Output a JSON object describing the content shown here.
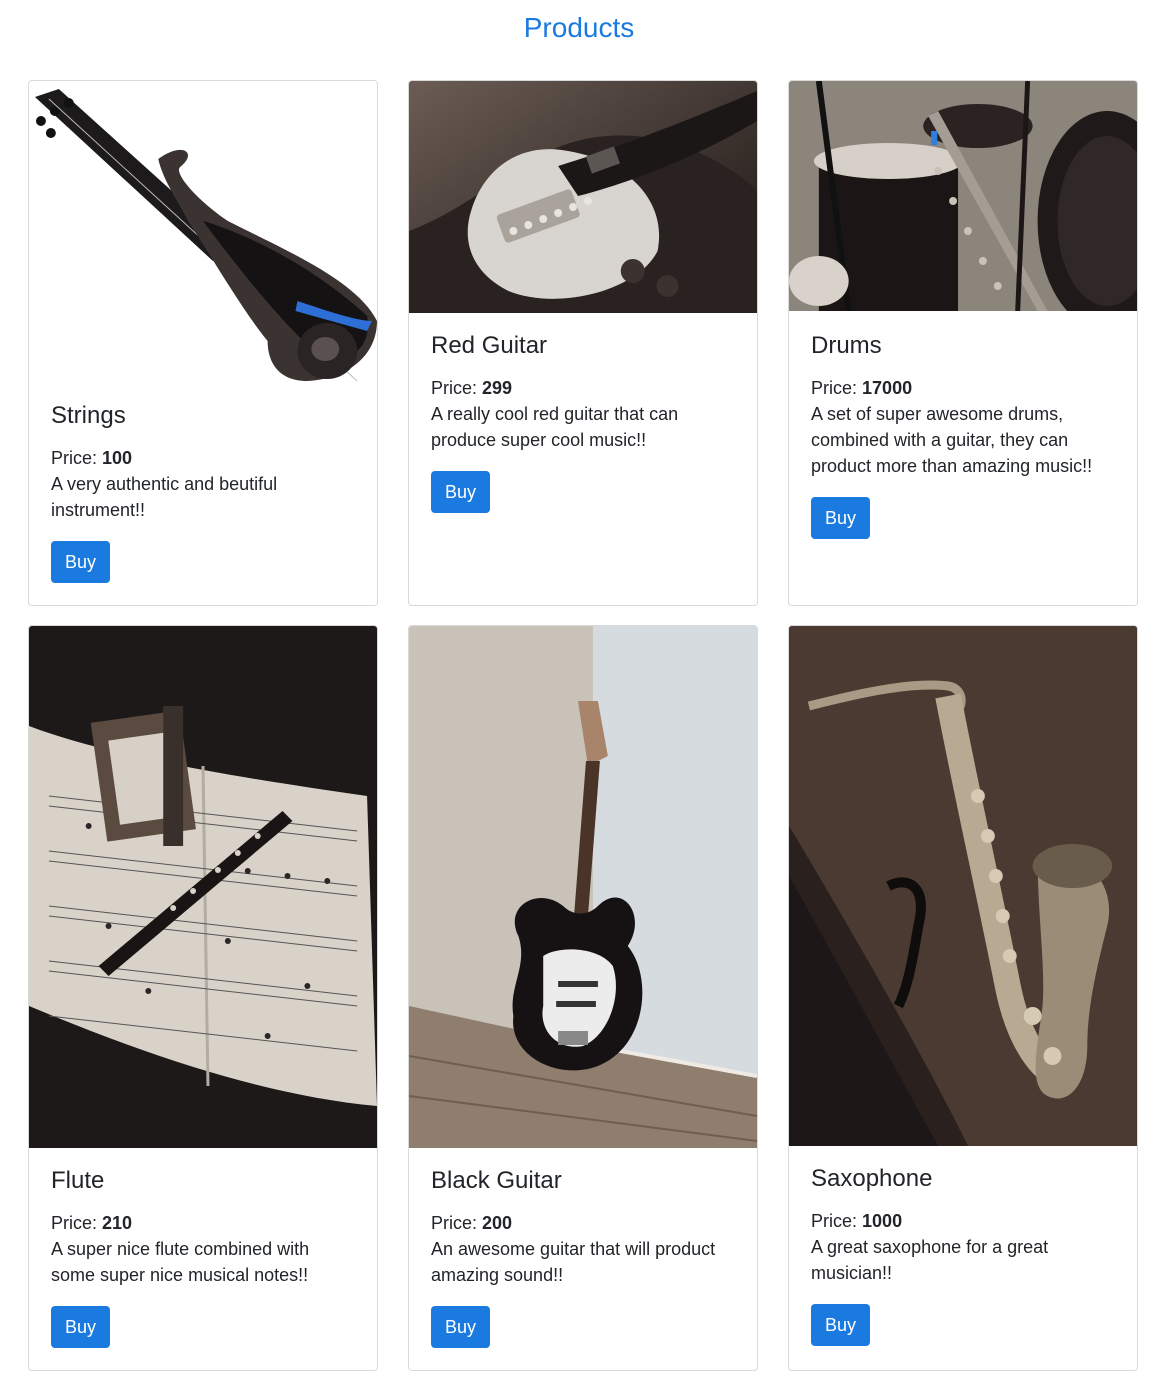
{
  "page": {
    "title": "Products"
  },
  "price_label": "Price:",
  "buy_label": "Buy",
  "products": [
    {
      "name": "Strings",
      "price": "100",
      "description": "A very authentic and beutiful instrument!!",
      "image_icon": "electric-violin-image"
    },
    {
      "name": "Red Guitar",
      "price": "299",
      "description": "A really cool red guitar that can produce super cool music!!",
      "image_icon": "electric-guitar-closeup-image"
    },
    {
      "name": "Drums",
      "price": "17000",
      "description": "A set of super awesome drums, combined with a guitar, they can product more than amazing music!!",
      "image_icon": "drum-kit-image"
    },
    {
      "name": "Flute",
      "price": "210",
      "description": "A super nice flute combined with some super nice musical notes!!",
      "image_icon": "recorder-on-sheet-music-image"
    },
    {
      "name": "Black Guitar",
      "price": "200",
      "description": "An awesome guitar that will product amazing sound!!",
      "image_icon": "black-guitar-in-corner-image"
    },
    {
      "name": "Saxophone",
      "price": "1000",
      "description": "A great saxophone for a great musician!!",
      "image_icon": "saxophone-image"
    }
  ],
  "colors": {
    "accent": "#1a7ae0",
    "card_border": "#d9d9d9",
    "text": "#212529"
  }
}
